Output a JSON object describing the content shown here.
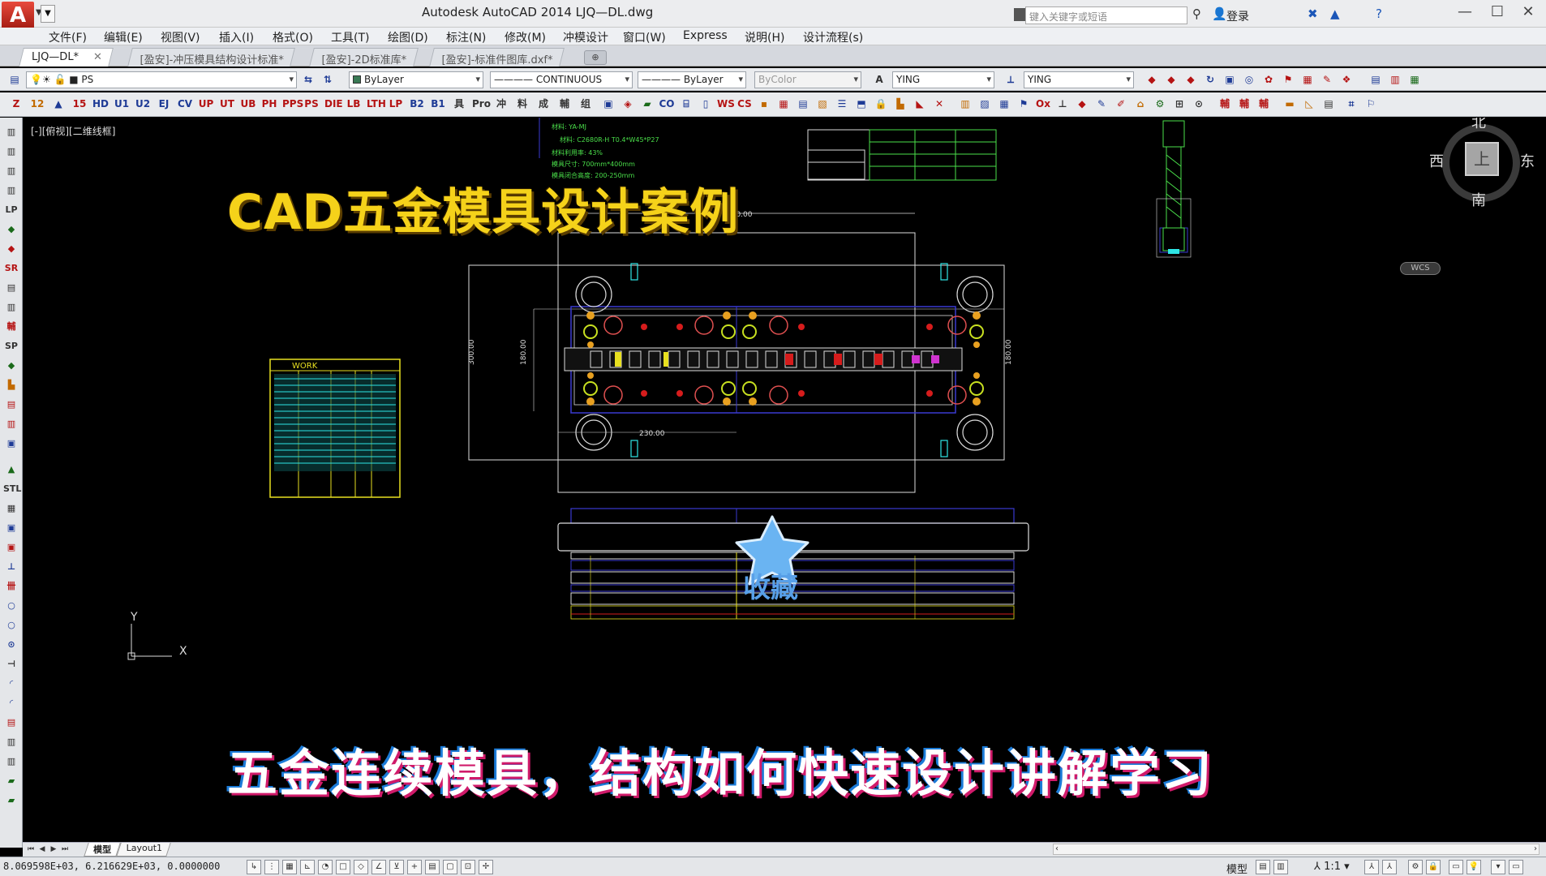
{
  "window": {
    "title": "Autodesk AutoCAD 2014     LJQ—DL.dwg",
    "logo_label": "A",
    "search_placeholder": "键入关键字或短语",
    "login": "登录",
    "minimize": "—",
    "maximize": "☐",
    "close": "✕"
  },
  "menu": [
    "文件(F)",
    "编辑(E)",
    "视图(V)",
    "插入(I)",
    "格式(O)",
    "工具(T)",
    "绘图(D)",
    "标注(N)",
    "修改(M)",
    "冲模设计",
    "窗口(W)",
    "Express",
    "说明(H)",
    "设计流程(s)"
  ],
  "tabs": [
    {
      "label": "LJQ—DL*",
      "active": true,
      "closable": true
    },
    {
      "label": "[盈安]-冲压模具结构设计标准*",
      "active": false
    },
    {
      "label": "[盈安]-2D标准库*",
      "active": false
    },
    {
      "label": "[盈安]-标准件图库.dxf*",
      "active": false
    }
  ],
  "toolbar": {
    "layer": "PS",
    "color": "ByLayer",
    "linetype": "———— CONTINUOUS",
    "lineweight": "———— ByLayer",
    "plotstyle": "ByColor",
    "text_style": "YING",
    "dim_style": "YING"
  },
  "toolbar2_icons": [
    "Z",
    "12",
    "▲",
    "15",
    "HD",
    "U1",
    "U2",
    "EJ",
    "CV",
    "UP",
    "UT",
    "UB",
    "PH",
    "PPS",
    "PS",
    "DIE",
    "LB",
    "LTH",
    "LP",
    "B2",
    "B1",
    "具",
    "Pro",
    "冲",
    "料",
    "成",
    "輔",
    "组"
  ],
  "viewport": {
    "label": "[-][俯视][二维线框]",
    "overlay_title": "CAD五金模具设计案例",
    "overlay_subtitle": "五金连续模具，结构如何快速设计讲解学习",
    "favorite_label": "收藏",
    "compass": {
      "north": "北",
      "south": "南",
      "west": "西",
      "east": "东",
      "face": "上"
    },
    "wcs": "WCS",
    "ucs_x": "X",
    "ucs_y": "Y",
    "dims": {
      "top": "920.00",
      "bottom": "230.00",
      "left": "300.00",
      "left2": "180.00",
      "right": "180.00"
    },
    "table_title": "WORK",
    "strip_note_lines": [
      "材料: YA-MJ",
      "材料: C2680R-H  T0.4*W45*P27",
      "材料利用率: 43%",
      "模具尺寸: 700mm*400mm",
      "模具闭合高度: 200-250mm"
    ]
  },
  "layouts": {
    "tabs": [
      "模型",
      "Layout1"
    ]
  },
  "statusbar": {
    "coords": "8.069598E+03, 6.216629E+03, 0.0000000",
    "model_label": "模型",
    "scale": "1:1"
  },
  "colors": {
    "background": "#000000",
    "title_overlay": "#f5d21a",
    "favorite": "#58a0e8",
    "die_outline": "#3a3ad0",
    "die_green": "#4adf4a"
  }
}
